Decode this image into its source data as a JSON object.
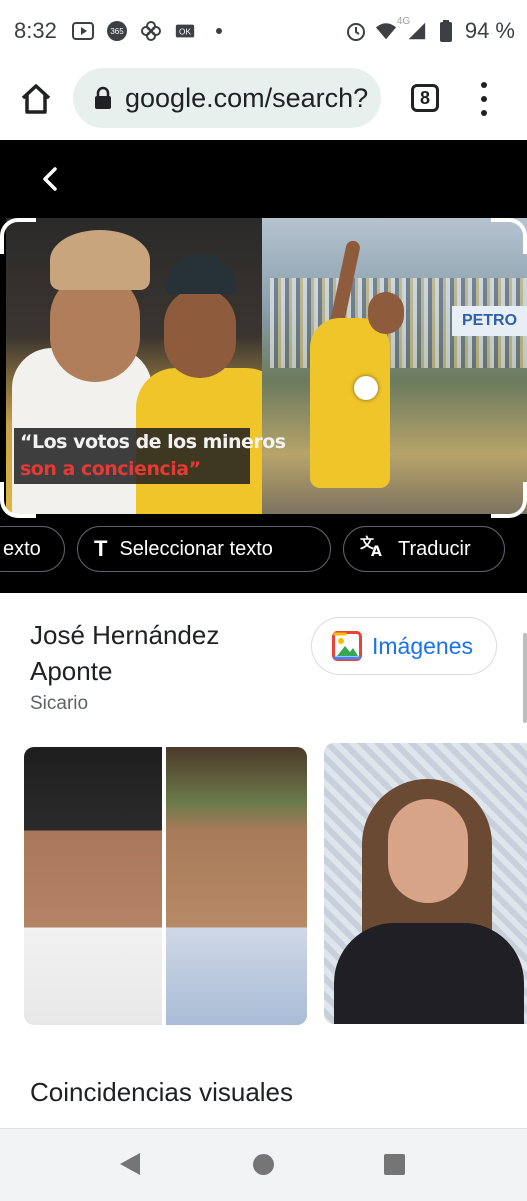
{
  "status_bar": {
    "time": "8:32",
    "battery": "94 %",
    "network": "4G"
  },
  "browser": {
    "url": "google.com/search?",
    "tab_count": "8"
  },
  "image_caption": {
    "line1": "“Los votos de los mineros",
    "line2": "son a conciencia”"
  },
  "actions": {
    "partial_chip": "exto",
    "select_text": "Seleccionar texto",
    "translate": "Traducir"
  },
  "result": {
    "title": "José Hernández Aponte",
    "subtitle": "Sicario",
    "images_button": "Imágenes"
  },
  "section_title": "Coincidencias visuales",
  "banner_sign_text": "PETRO",
  "colors": {
    "accent": "#1a73e8",
    "url_pill": "#e8f0ed",
    "caption_red": "#e53935"
  }
}
